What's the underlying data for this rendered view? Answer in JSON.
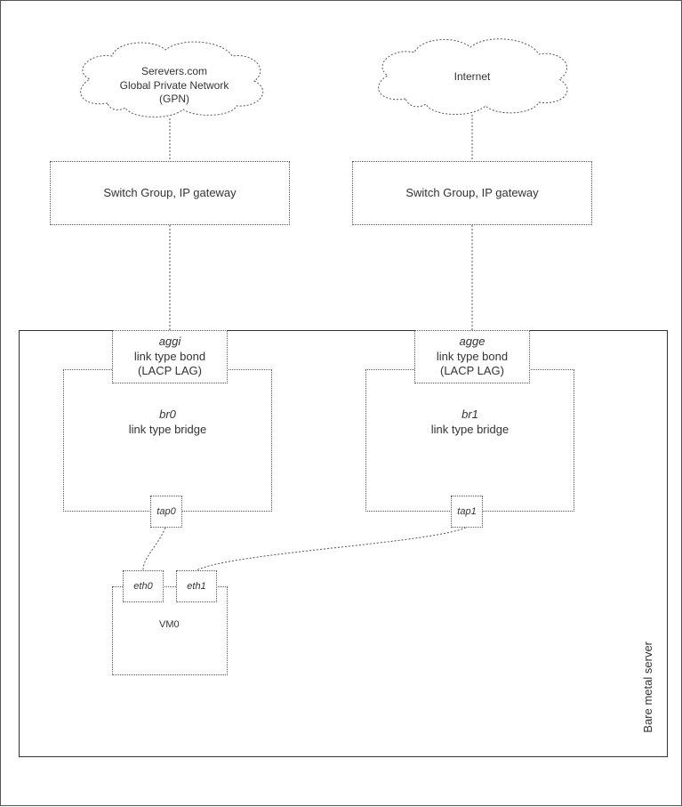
{
  "clouds": {
    "gpn": {
      "line1": "Serevers.com",
      "line2": "Global Private Network",
      "line3": "(GPN)"
    },
    "internet": {
      "label": "Internet"
    }
  },
  "switches": {
    "left": {
      "label": "Switch Group,  IP gateway"
    },
    "right": {
      "label": "Switch Group,  IP gateway"
    }
  },
  "server_label": "Bare metal server",
  "bonds": {
    "aggi": {
      "name": "aggi",
      "sub1": "link type bond",
      "sub2": "(LACP LAG)"
    },
    "agge": {
      "name": "agge",
      "sub1": "link type bond",
      "sub2": "(LACP LAG)"
    }
  },
  "bridges": {
    "br0": {
      "name": "br0",
      "sub": "link type bridge"
    },
    "br1": {
      "name": "br1",
      "sub": "link type bridge"
    }
  },
  "taps": {
    "tap0": "tap0",
    "tap1": "tap1"
  },
  "vm": {
    "name": "VM0",
    "eth0": "eth0",
    "eth1": "eth1"
  }
}
